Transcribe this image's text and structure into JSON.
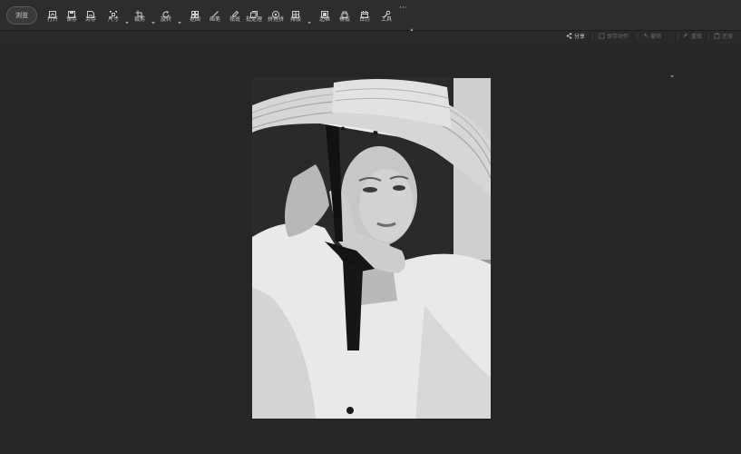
{
  "toolbar": {
    "browse_label": "浏览",
    "items": [
      {
        "label": "打开",
        "icon": "open-icon"
      },
      {
        "label": "保存",
        "icon": "save-icon"
      },
      {
        "label": "另存",
        "icon": "save-as-icon"
      },
      {
        "label": "尺寸",
        "icon": "resize-icon"
      },
      {
        "label": "裁剪",
        "icon": "crop-icon"
      },
      {
        "label": "旋转",
        "icon": "rotate-icon"
      },
      {
        "label": "抠图",
        "icon": "cutout-icon"
      },
      {
        "label": "画笔",
        "icon": "brush-icon"
      },
      {
        "label": "祛斑",
        "icon": "spot-remove-icon"
      },
      {
        "label": "批处理",
        "icon": "batch-icon"
      },
      {
        "label": "拼拖拼",
        "icon": "collage-icon"
      },
      {
        "label": "排版",
        "icon": "layout-icon"
      },
      {
        "label": "边框",
        "icon": "frame-icon"
      },
      {
        "label": "模板",
        "icon": "template-icon"
      },
      {
        "label": "日历",
        "icon": "calendar-icon"
      },
      {
        "label": "工具",
        "icon": "tools-icon"
      }
    ],
    "more_label": "···"
  },
  "subbar": {
    "share": "分享",
    "save_action": "保存动作",
    "undo": "撤销",
    "redo": "重做",
    "restore": "还原"
  },
  "colors": {
    "toolbar_bg": "#2d2d2d",
    "canvas_bg": "#262626",
    "text": "#c8c8c8",
    "disabled_text": "#6a6a6a"
  }
}
